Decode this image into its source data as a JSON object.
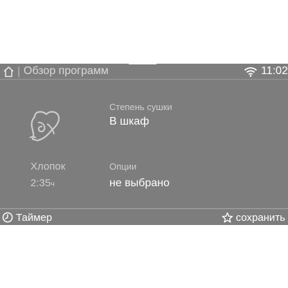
{
  "header": {
    "separator": "|",
    "title": "Обзор программ",
    "time": "11:02"
  },
  "program": {
    "icon": "cotton-icon",
    "name": "Хлопок",
    "duration": "2:35",
    "duration_unit": "ч"
  },
  "options": [
    {
      "label": "Степень сушки",
      "value": "В шкаф"
    },
    {
      "label": "Опции",
      "value": "не выбрано"
    }
  ],
  "footer": {
    "timer_label": "Таймер",
    "save_label": "сохранить"
  },
  "colors": {
    "panel": "#7d7d7d",
    "text": "#ffffff",
    "muted_text": "#cfcfcf"
  }
}
